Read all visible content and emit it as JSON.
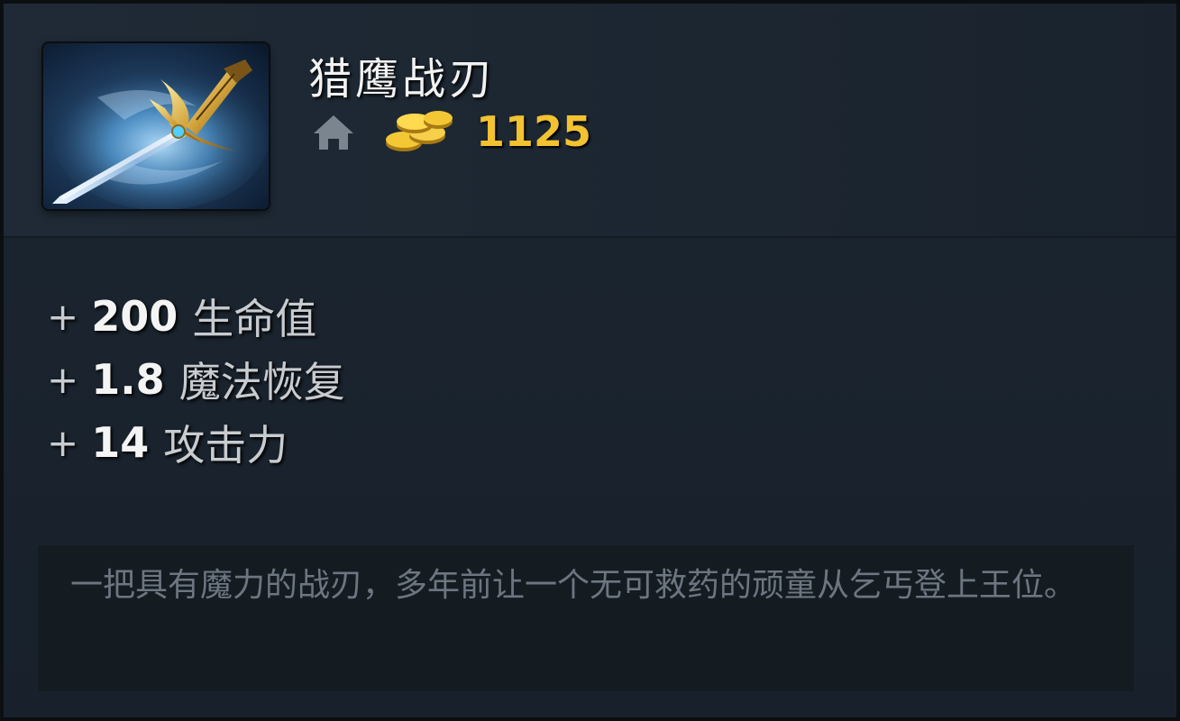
{
  "item": {
    "name": "猎鹰战刃",
    "icon": "falcon-blade-sword-icon",
    "cost": "1125",
    "shop_icon": "home-icon",
    "currency_icon": "gold-coins-icon"
  },
  "stats": [
    {
      "plus": "+",
      "value": "200",
      "label": "生命值"
    },
    {
      "plus": "+",
      "value": "1.8",
      "label": "魔法恢复"
    },
    {
      "plus": "+",
      "value": "14",
      "label": "攻击力"
    }
  ],
  "lore": "一把具有魔力的战刃，多年前让一个无可救药的顽童从乞丐登上王位。",
  "colors": {
    "gold": "#f2c230",
    "stat_value": "#f4f4f4",
    "stat_label": "#c8ccd0",
    "lore_text": "#6d7680",
    "background": "#1b2530"
  }
}
